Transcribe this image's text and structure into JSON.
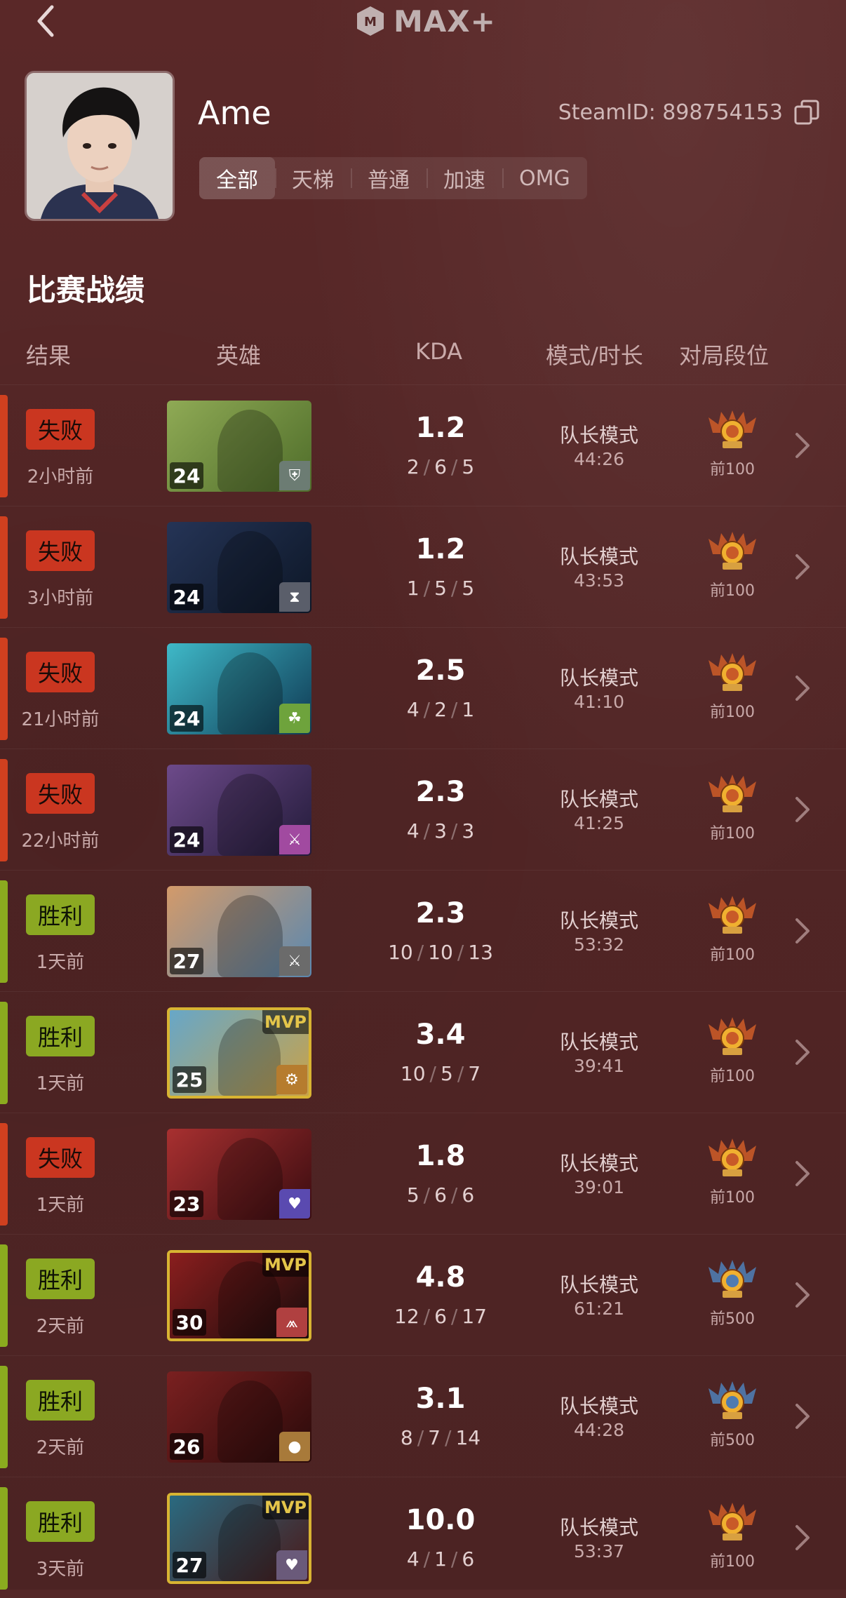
{
  "app": {
    "logo_text": "MAX+"
  },
  "profile": {
    "name": "Ame",
    "steam_id": "SteamID: 898754153",
    "filters": [
      "全部",
      "天梯",
      "普通",
      "加速",
      "OMG"
    ]
  },
  "section_title": "比赛战绩",
  "columns": {
    "result": "结果",
    "hero": "英雄",
    "kda": "KDA",
    "mode": "模式/时长",
    "rank": "对局段位"
  },
  "matches": [
    {
      "result": "失败",
      "outcome": "loss",
      "time_ago": "2小时前",
      "level": "24",
      "mvp": false,
      "kda": "1.2",
      "k": "2",
      "d": "6",
      "a": "5",
      "mode": "队长模式",
      "duration": "44:26",
      "rank": "前100",
      "rank_color": "#c85a28",
      "hero_colors": [
        "#8faa55",
        "#4f6d2a"
      ],
      "role_icon": "shield-icon",
      "role_color": "#6c7c73"
    },
    {
      "result": "失败",
      "outcome": "loss",
      "time_ago": "3小时前",
      "level": "24",
      "mvp": false,
      "kda": "1.2",
      "k": "1",
      "d": "5",
      "a": "5",
      "mode": "队长模式",
      "duration": "43:53",
      "rank": "前100",
      "rank_color": "#c85a28",
      "hero_colors": [
        "#253456",
        "#0d1727"
      ],
      "role_icon": "hourglass-icon",
      "role_color": "#5a5e6a"
    },
    {
      "result": "失败",
      "outcome": "loss",
      "time_ago": "21小时前",
      "level": "24",
      "mvp": false,
      "kda": "2.5",
      "k": "4",
      "d": "2",
      "a": "1",
      "mode": "队长模式",
      "duration": "41:10",
      "rank": "前100",
      "rank_color": "#c85a28",
      "hero_colors": [
        "#3fb9c8",
        "#0f3a54"
      ],
      "role_icon": "leaf-icon",
      "role_color": "#6ea33c"
    },
    {
      "result": "失败",
      "outcome": "loss",
      "time_ago": "22小时前",
      "level": "24",
      "mvp": false,
      "kda": "2.3",
      "k": "4",
      "d": "3",
      "a": "3",
      "mode": "队长模式",
      "duration": "41:25",
      "rank": "前100",
      "rank_color": "#c85a28",
      "hero_colors": [
        "#6d4a8a",
        "#231b3a"
      ],
      "role_icon": "dagger-icon",
      "role_color": "#a14aa0"
    },
    {
      "result": "胜利",
      "outcome": "win",
      "time_ago": "1天前",
      "level": "27",
      "mvp": false,
      "kda": "2.3",
      "k": "10",
      "d": "10",
      "a": "13",
      "mode": "队长模式",
      "duration": "53:32",
      "rank": "前100",
      "rank_color": "#c85a28",
      "hero_colors": [
        "#d39a6a",
        "#5a88b0"
      ],
      "role_icon": "sword-icon",
      "role_color": "#6b6b6b"
    },
    {
      "result": "胜利",
      "outcome": "win",
      "time_ago": "1天前",
      "level": "25",
      "mvp": true,
      "kda": "3.4",
      "k": "10",
      "d": "5",
      "a": "7",
      "mode": "队长模式",
      "duration": "39:41",
      "rank": "前100",
      "rank_color": "#c85a28",
      "hero_colors": [
        "#67a7c8",
        "#c8a24a"
      ],
      "role_icon": "gadget-icon",
      "role_color": "#b67c2e"
    },
    {
      "result": "失败",
      "outcome": "loss",
      "time_ago": "1天前",
      "level": "23",
      "mvp": false,
      "kda": "1.8",
      "k": "5",
      "d": "6",
      "a": "6",
      "mode": "队长模式",
      "duration": "39:01",
      "rank": "前100",
      "rank_color": "#c85a28",
      "hero_colors": [
        "#a83030",
        "#3a0c10"
      ],
      "role_icon": "heart-icon",
      "role_color": "#5a4ab0"
    },
    {
      "result": "胜利",
      "outcome": "win",
      "time_ago": "2天前",
      "level": "30",
      "mvp": true,
      "kda": "4.8",
      "k": "12",
      "d": "6",
      "a": "17",
      "mode": "队长模式",
      "duration": "61:21",
      "rank": "前500",
      "rank_color": "#4f7bb0",
      "hero_colors": [
        "#8a1e1e",
        "#1a0c0c"
      ],
      "role_icon": "claw-icon",
      "role_color": "#b04040"
    },
    {
      "result": "胜利",
      "outcome": "win",
      "time_ago": "2天前",
      "level": "26",
      "mvp": false,
      "kda": "3.1",
      "k": "8",
      "d": "7",
      "a": "14",
      "mode": "队长模式",
      "duration": "44:28",
      "rank": "前500",
      "rank_color": "#4f7bb0",
      "hero_colors": [
        "#7a2020",
        "#2a0a0a"
      ],
      "role_icon": "coin-icon",
      "role_color": "#a87a3a"
    },
    {
      "result": "胜利",
      "outcome": "win",
      "time_ago": "3天前",
      "level": "27",
      "mvp": true,
      "kda": "10.0",
      "k": "4",
      "d": "1",
      "a": "6",
      "mode": "队长模式",
      "duration": "53:37",
      "rank": "前100",
      "rank_color": "#c85a28",
      "hero_colors": [
        "#2a6a80",
        "#4a1a1a"
      ],
      "role_icon": "heart-icon",
      "role_color": "#6a5a7a"
    }
  ]
}
